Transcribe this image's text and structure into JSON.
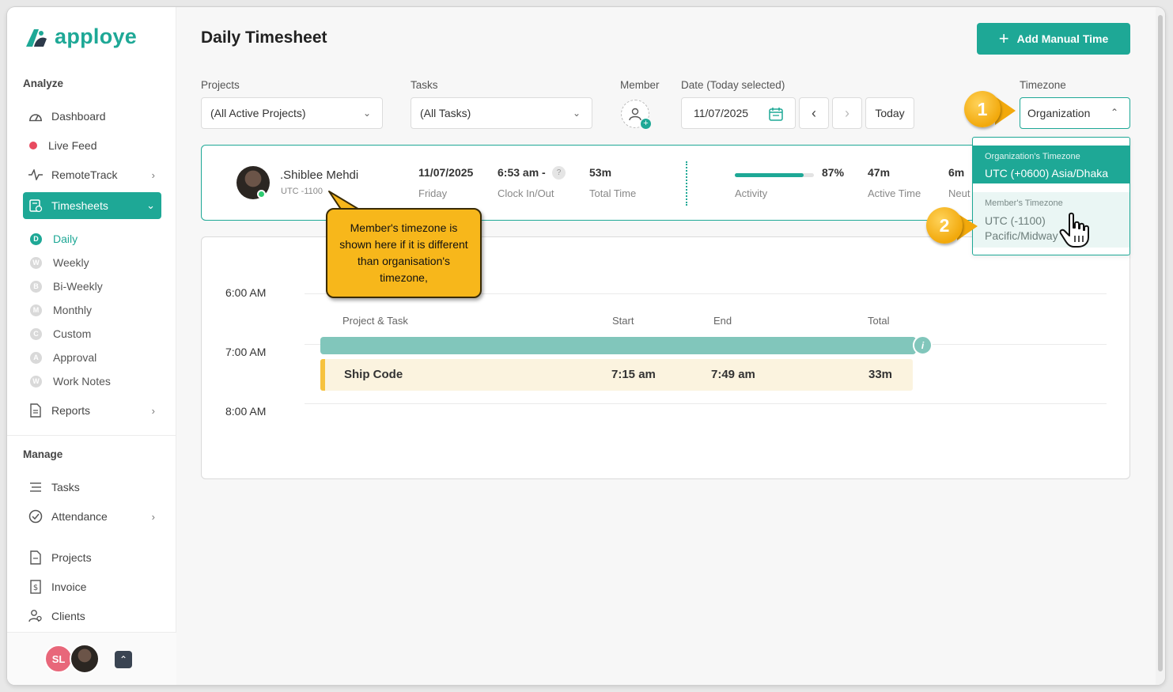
{
  "app": {
    "name": "apploye",
    "brand_color": "#1ea896"
  },
  "sidebar": {
    "analyze_title": "Analyze",
    "manage_title": "Manage",
    "items": [
      {
        "label": "Dashboard",
        "icon": "dashboard-icon"
      },
      {
        "label": "Live Feed",
        "icon": "live-dot"
      },
      {
        "label": "RemoteTrack",
        "icon": "pulse-icon"
      },
      {
        "label": "Timesheets",
        "icon": "timesheet-icon",
        "active": true
      },
      {
        "label": "Reports",
        "icon": "report-icon"
      }
    ],
    "timesheet_sub": [
      {
        "badge": "D",
        "label": "Daily",
        "active": true
      },
      {
        "badge": "W",
        "label": "Weekly"
      },
      {
        "badge": "B",
        "label": "Bi-Weekly"
      },
      {
        "badge": "M",
        "label": "Monthly"
      },
      {
        "badge": "C",
        "label": "Custom"
      },
      {
        "badge": "A",
        "label": "Approval"
      },
      {
        "badge": "W",
        "label": "Work Notes"
      }
    ],
    "manage_items": [
      {
        "label": "Tasks",
        "icon": "list-icon"
      },
      {
        "label": "Attendance",
        "icon": "check-circle-icon"
      },
      {
        "label": "Projects",
        "icon": "document-icon"
      },
      {
        "label": "Invoice",
        "icon": "invoice-icon"
      },
      {
        "label": "Clients",
        "icon": "clients-icon"
      }
    ],
    "footer": {
      "user_initials": "SL"
    }
  },
  "header": {
    "title": "Daily Timesheet",
    "add_button": "Add Manual Time"
  },
  "filters": {
    "projects_label": "Projects",
    "projects_value": "(All Active Projects)",
    "tasks_label": "Tasks",
    "tasks_value": "(All Tasks)",
    "member_label": "Member",
    "date_label": "Date (Today selected)",
    "date_value": "11/07/2025",
    "today_button": "Today",
    "timezone_label": "Timezone",
    "timezone_value": "Organization"
  },
  "member_card": {
    "name": ".Shiblee Mehdi",
    "timezone": "UTC -1100",
    "date": "11/07/2025",
    "day": "Friday",
    "clock": "6:53 am -",
    "clock_label": "Clock In/Out",
    "clock_help": "?",
    "total_time": "53m",
    "total_label": "Total Time",
    "activity_pct": "87%",
    "activity_fraction": 0.87,
    "activity_label": "Activity",
    "active_time": "47m",
    "active_label": "Active Time",
    "neutral_time": "6m",
    "neutral_label": "Neut"
  },
  "timezone_dropdown": {
    "org_title": "Organization's Timezone",
    "org_value": "UTC (+0600) Asia/Dhaka",
    "member_title": "Member's Timezone",
    "member_value": "UTC (-1100) Pacific/Midway"
  },
  "timeline": {
    "hours": [
      "6:00 AM",
      "7:00 AM",
      "8:00 AM"
    ],
    "columns": {
      "project_task": "Project & Task",
      "start": "Start",
      "end": "End",
      "total": "Total"
    },
    "info_icon": "i",
    "entries": [
      {
        "task": "Ship Code",
        "start": "7:15 am",
        "end": "7:49 am",
        "total": "33m"
      }
    ]
  },
  "annotations": {
    "callout": "Member's timezone is shown here if it is different than organisation's timezone,",
    "step1": "1",
    "step2": "2"
  }
}
